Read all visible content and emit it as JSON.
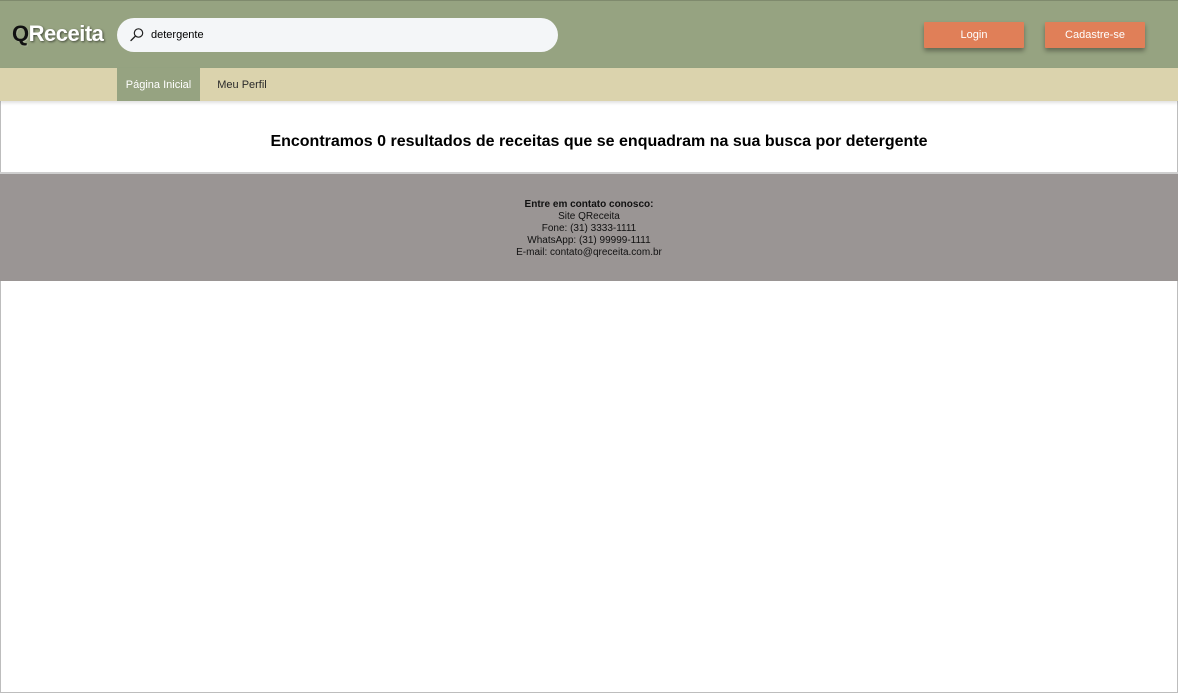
{
  "header": {
    "logo_q": "Q",
    "logo_rest": "Receita",
    "search": {
      "value": "detergente",
      "icon": "search-icon"
    },
    "login_label": "Login",
    "signup_label": "Cadastre-se"
  },
  "nav": {
    "items": [
      {
        "label": "Página Inicial",
        "active": true
      },
      {
        "label": "Meu Perfil",
        "active": false
      }
    ]
  },
  "main": {
    "result_text": "Encontramos 0 resultados de receitas que se enquadram na sua busca por detergente"
  },
  "footer": {
    "heading": "Entre em contato conosco:",
    "site": "Site QReceita",
    "phone": "Fone: (31) 3333-1111",
    "whatsapp": "WhatsApp: (31) 99999-1111",
    "email": "E-mail: contato@qreceita.com.br"
  },
  "colors": {
    "header_bg": "#96a381",
    "nav_bg": "#dbd3ad",
    "button_bg": "#e07f58",
    "footer_bg": "#9a9594"
  }
}
